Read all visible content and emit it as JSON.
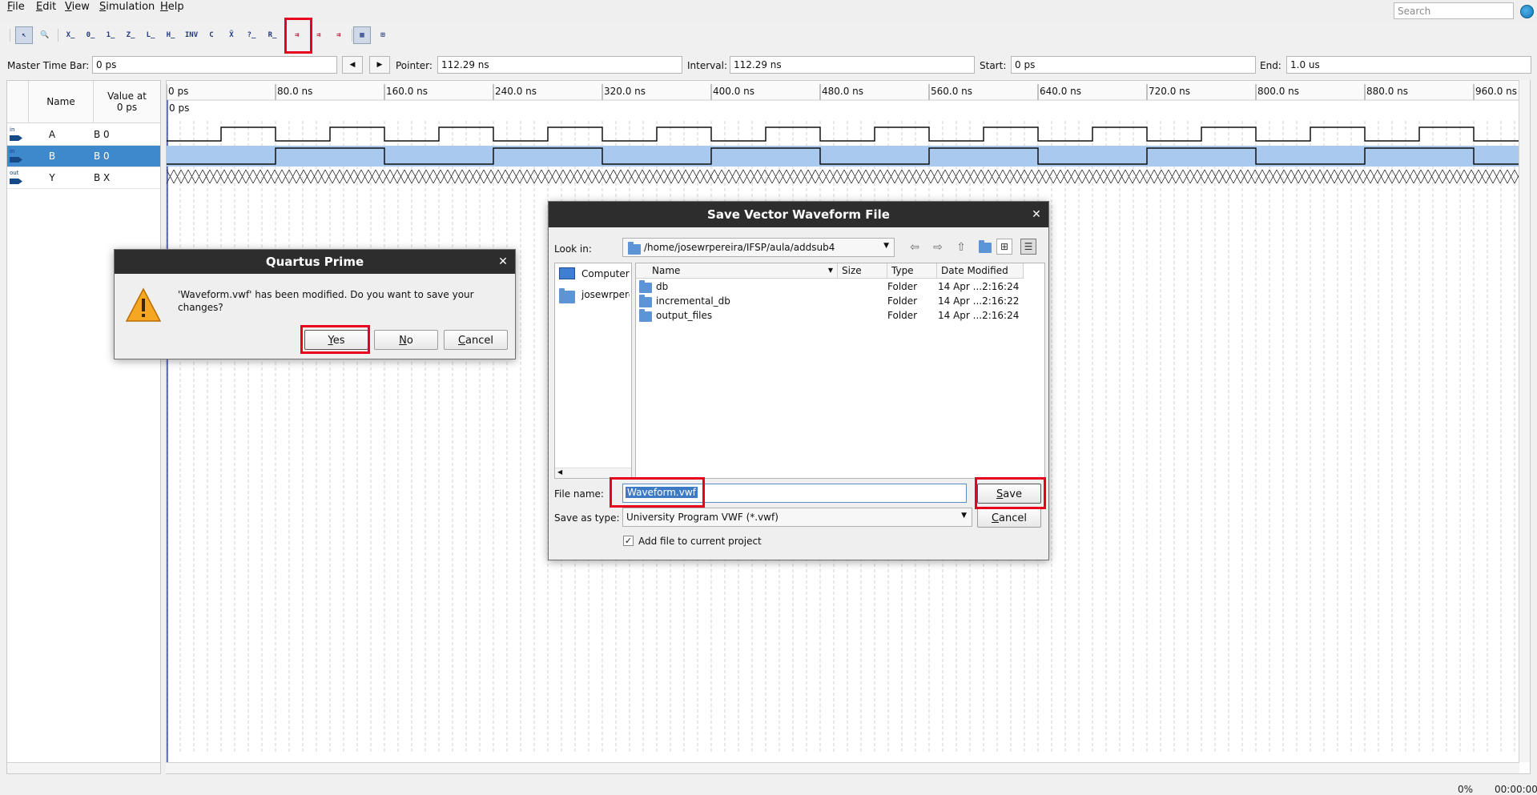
{
  "menu": [
    "File",
    "Edit",
    "View",
    "Simulation",
    "Help"
  ],
  "search": {
    "placeholder": "Search"
  },
  "toolbar": {
    "icons": [
      "selection-tool-icon",
      "zoom-tool-icon",
      "force-unknown-icon",
      "force-low-icon",
      "force-high-icon",
      "force-hiz-icon",
      "force-weak-low-icon",
      "force-weak-high-icon",
      "invert-icon",
      "count-value-icon",
      "clock-value-icon",
      "arbitrary-value-icon",
      "random-value-icon",
      "run-functional-simulation-icon",
      "run-timing-simulation-icon",
      "generate-testbench-icon",
      "snap-to-grid-icon",
      "grid-settings-icon"
    ],
    "glyphs": [
      "↖",
      "🔍",
      "X̲",
      "0̲",
      "1̲",
      "Z̲",
      "L̲",
      "H̲",
      "INV",
      "C",
      "X̃",
      "?̲",
      "R̲",
      "⇉",
      "⇉",
      "⇉",
      "▦",
      "⊞"
    ]
  },
  "timebar": {
    "master_label": "Master Time Bar:",
    "master_value": "0 ps",
    "pointer_label": "Pointer:",
    "pointer_value": "112.29 ns",
    "interval_label": "Interval:",
    "interval_value": "112.29 ns",
    "start_label": "Start:",
    "start_value": "0 ps",
    "end_label": "End:",
    "end_value": "1.0 us"
  },
  "signal_table": {
    "col_name": "Name",
    "col_value": "Value at\n0 ps",
    "rows": [
      {
        "name": "A",
        "value": "B 0",
        "dir": "in"
      },
      {
        "name": "B",
        "value": "B 0",
        "dir": "in"
      },
      {
        "name": "Y",
        "value": "B X",
        "dir": "out"
      }
    ]
  },
  "waveform": {
    "time_labels": [
      "0 ps",
      "80.0 ns",
      "160.0 ns",
      "240.0 ns",
      "320.0 ns",
      "400.0 ns",
      "480.0 ns",
      "560.0 ns",
      "640.0 ns",
      "720.0 ns",
      "800.0 ns",
      "880.0 ns",
      "960.0 ns"
    ],
    "cursor_label": "0 ps",
    "range_end_ns": 1000,
    "A_period_ns": 80,
    "B_period_ns": 160,
    "B_fill_color": "#a9c9ef"
  },
  "status": {
    "progress": "0%",
    "elapsed": "00:00:00"
  },
  "quartus_dialog": {
    "title": "Quartus Prime",
    "message": "'Waveform.vwf' has been modified. Do you want to save your changes?",
    "yes": "Yes",
    "no": "No",
    "cancel": "Cancel"
  },
  "save_dialog": {
    "title": "Save Vector Waveform File",
    "look_in_label": "Look in:",
    "look_in_path": "/home/josewrpereira/IFSP/aula/addsub4",
    "sidebar": [
      "Computer",
      "josewrpereira"
    ],
    "columns": {
      "name": "Name",
      "size": "Size",
      "type": "Type",
      "date": "Date Modified"
    },
    "files": [
      {
        "name": "db",
        "size": "",
        "type": "Folder",
        "date": "14 Apr ...2:16:24"
      },
      {
        "name": "incremental_db",
        "size": "",
        "type": "Folder",
        "date": "14 Apr ...2:16:22"
      },
      {
        "name": "output_files",
        "size": "",
        "type": "Folder",
        "date": "14 Apr ...2:16:24"
      }
    ],
    "file_name_label": "File name:",
    "file_name_value": "Waveform.vwf",
    "save_as_label": "Save as type:",
    "save_as_value": "University Program VWF (*.vwf)",
    "add_to_project_label": "Add file to current project",
    "add_to_project_checked": true,
    "save": "Save",
    "cancel": "Cancel"
  },
  "highlight_color": "#e8001c"
}
